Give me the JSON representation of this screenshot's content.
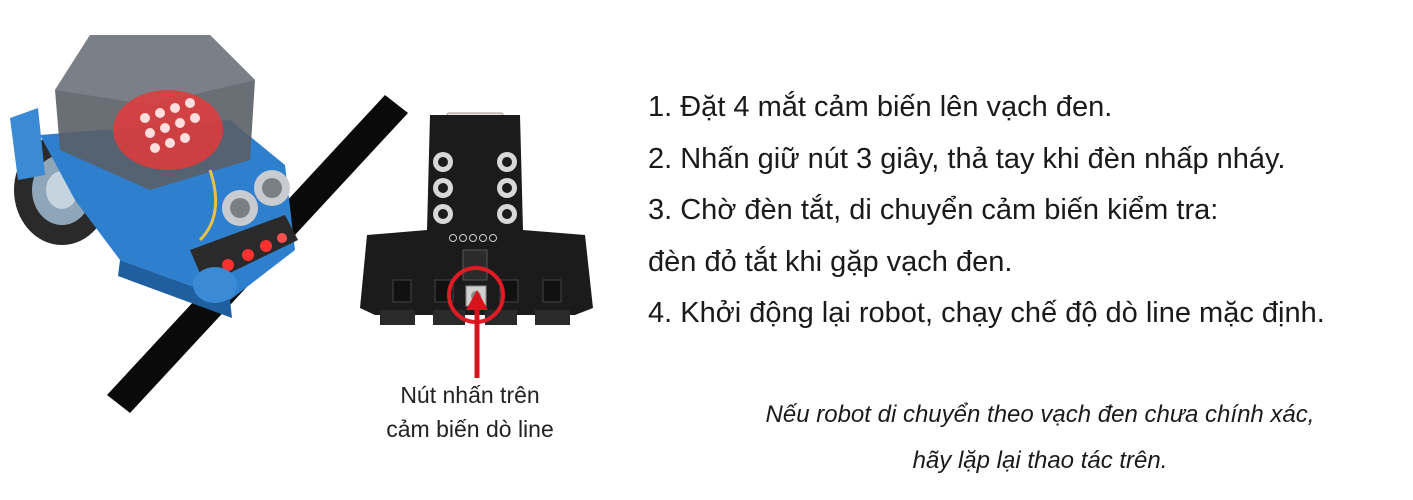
{
  "caption": {
    "line1": "Nút nhấn trên",
    "line2": "cảm biến dò line"
  },
  "instructions": {
    "steps": [
      "1. Đặt 4 mắt cảm biến lên vạch đen.",
      "2. Nhấn giữ nút 3 giây, thả tay khi đèn nhấp nháy.",
      "3. Chờ đèn tắt, di chuyển cảm biến kiểm tra:",
      "đèn đỏ tắt khi gặp vạch đen.",
      "4. Khởi động lại robot, chạy chế độ dò line mặc định."
    ]
  },
  "note": {
    "line1": "Nếu robot di chuyển theo vạch đen chưa chính xác,",
    "line2": "hãy lặp lại thao tác trên."
  },
  "colors": {
    "highlight_circle": "#e01b24",
    "arrow": "#d7141c",
    "robot_body": "#2e7fd0",
    "pcb": "#1b1b1b"
  }
}
